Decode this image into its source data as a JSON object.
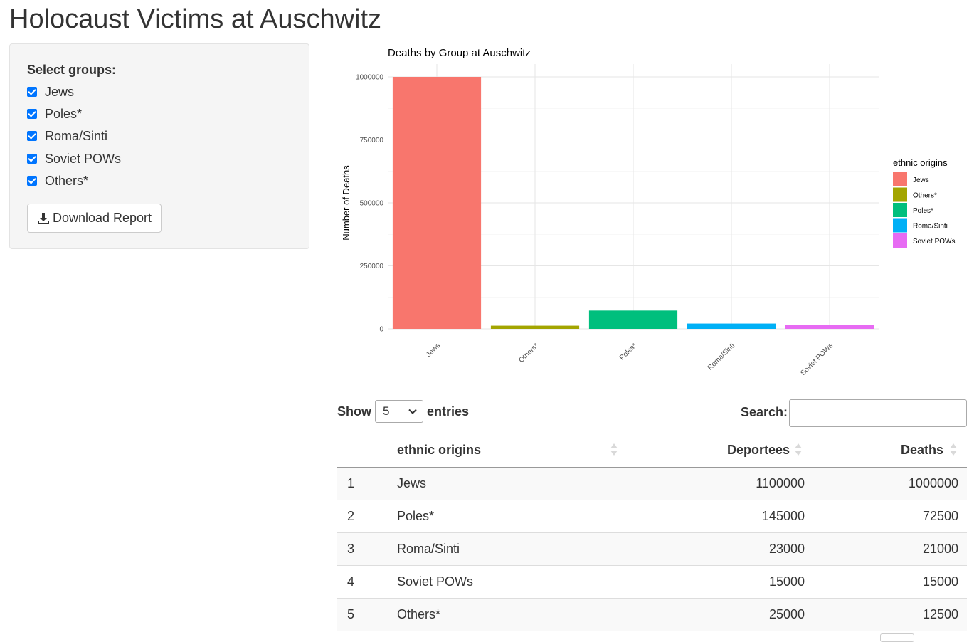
{
  "page": {
    "title": "Holocaust Victims at Auschwitz"
  },
  "sidebar": {
    "group_label": "Select groups:",
    "checkboxes": [
      {
        "label": "Jews",
        "checked": true
      },
      {
        "label": "Poles*",
        "checked": true
      },
      {
        "label": "Roma/Sinti",
        "checked": true
      },
      {
        "label": "Soviet POWs",
        "checked": true
      },
      {
        "label": "Others*",
        "checked": true
      }
    ],
    "download_label": "Download Report"
  },
  "chart_data": {
    "type": "bar",
    "title": "Deaths by Group at Auschwitz",
    "xlabel": "",
    "ylabel": "Number of Deaths",
    "categories": [
      "Jews",
      "Others*",
      "Poles*",
      "Roma/Sinti",
      "Soviet POWs"
    ],
    "values": [
      1000000,
      12500,
      72500,
      21000,
      15000
    ],
    "colors": [
      "#F8766D",
      "#A3A500",
      "#00BF7D",
      "#00B0F6",
      "#E76BF3"
    ],
    "yticks": [
      0,
      250000,
      500000,
      750000,
      1000000
    ],
    "ylim": [
      0,
      1000000
    ],
    "grid": true,
    "legend": {
      "title": "ethnic origins",
      "position": "right",
      "entries": [
        "Jews",
        "Others*",
        "Poles*",
        "Roma/Sinti",
        "Soviet POWs"
      ]
    }
  },
  "table": {
    "show_label": "Show",
    "entries_label": "entries",
    "page_length": "5",
    "search_label": "Search:",
    "search_value": "",
    "columns": [
      "",
      "ethnic origins",
      "Deportees",
      "Deaths"
    ],
    "rows": [
      [
        "1",
        "Jews",
        "1100000",
        "1000000"
      ],
      [
        "2",
        "Poles*",
        "145000",
        "72500"
      ],
      [
        "3",
        "Roma/Sinti",
        "23000",
        "21000"
      ],
      [
        "4",
        "Soviet POWs",
        "15000",
        "15000"
      ],
      [
        "5",
        "Others*",
        "25000",
        "12500"
      ]
    ]
  }
}
